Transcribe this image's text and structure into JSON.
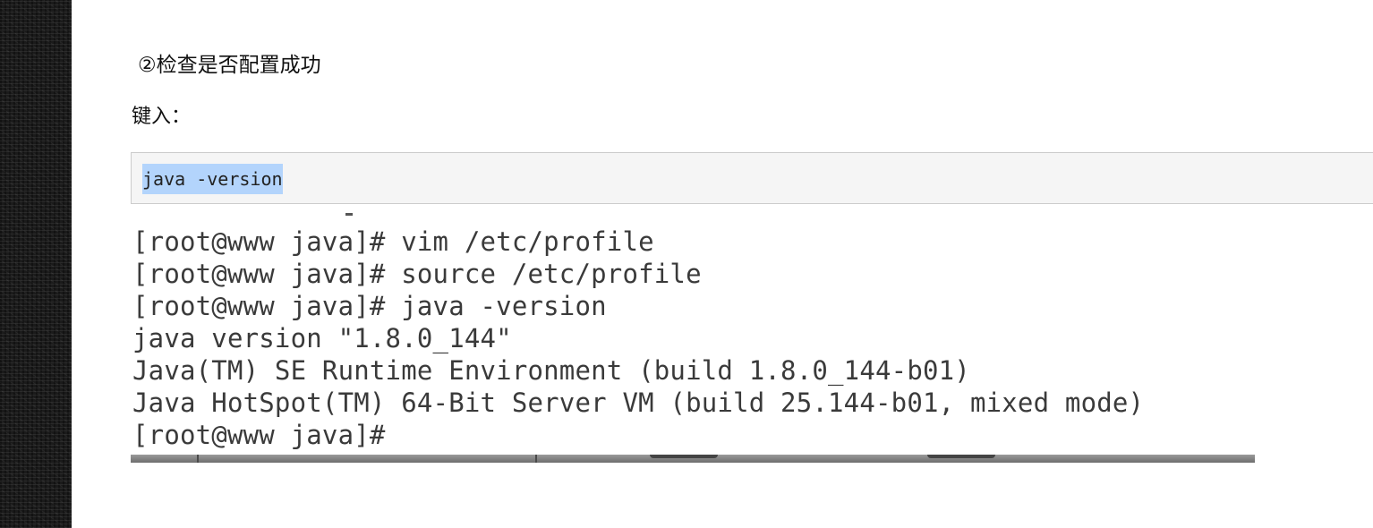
{
  "article": {
    "step_heading": "②检查是否配置成功",
    "input_label": "键入：",
    "code_block": {
      "text": "java -version"
    }
  },
  "terminal_screenshot": {
    "lines": [
      "[root@www java]# vim /etc/profile",
      "[root@www java]# source /etc/profile",
      "[root@www java]# java -version",
      "java version \"1.8.0_144\"",
      "Java(TM) SE Runtime Environment (build 1.8.0_144-b01)",
      "Java HotSpot(TM) 64-Bit Server VM (build 25.144-b01, mixed mode)",
      "[root@www java]#"
    ]
  },
  "colors": {
    "selection_highlight": "#b3d4fc",
    "code_background": "#f5f5f5",
    "terminal_text": "#3a3a3a",
    "left_strip": "#1b1b1b"
  }
}
